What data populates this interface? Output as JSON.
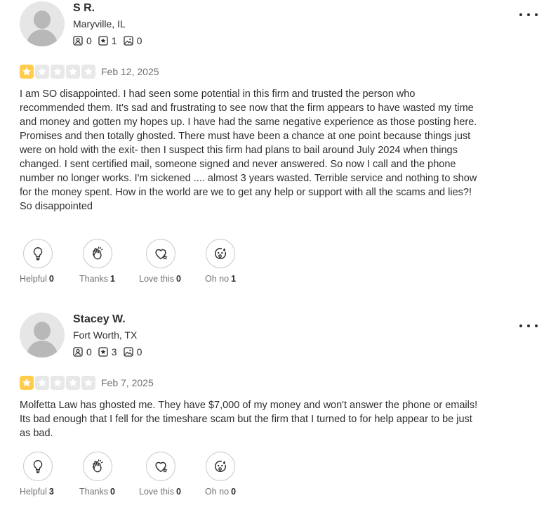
{
  "reviews": [
    {
      "user": {
        "name": "S R.",
        "location": "Maryville, IL",
        "friends": "0",
        "reviews": "1",
        "photos": "0"
      },
      "rating": 1,
      "date": "Feb 12, 2025",
      "text": [
        "I am SO disappointed. I had seen some potential in this firm and trusted the person who recommended them. It's sad and frustrating to see now that the firm appears to have wasted my time and money and gotten my hopes up. I have had the same negative experience as those posting here. Promises and then totally ghosted. There must have been a chance at one point because things just were on hold with the exit- then I suspect this firm had plans to bail around July 2024 when things changed. I sent certified mail, someone signed and never answered. So now I call and the phone number no longer works. I'm sickened .... almost 3 years wasted. Terrible service and nothing to show for the money spent. How in the world are we to get any help or support with all the scams and lies?!",
        "So disappointed"
      ],
      "reactions": {
        "helpful": {
          "label": "Helpful",
          "count": "0"
        },
        "thanks": {
          "label": "Thanks",
          "count": "1"
        },
        "love": {
          "label": "Love this",
          "count": "0"
        },
        "ohno": {
          "label": "Oh no",
          "count": "1"
        }
      }
    },
    {
      "user": {
        "name": "Stacey W.",
        "location": "Fort Worth, TX",
        "friends": "0",
        "reviews": "3",
        "photos": "0"
      },
      "rating": 1,
      "date": "Feb 7, 2025",
      "text": [
        "Molfetta Law has ghosted me. They have $7,000 of my money and won't answer the phone or emails! Its bad enough that I fell for the timeshare scam but the firm that I turned to for help appear to be just as bad."
      ],
      "reactions": {
        "helpful": {
          "label": "Helpful",
          "count": "3"
        },
        "thanks": {
          "label": "Thanks",
          "count": "0"
        },
        "love": {
          "label": "Love this",
          "count": "0"
        },
        "ohno": {
          "label": "Oh no",
          "count": "0"
        }
      }
    }
  ],
  "icons": {
    "friends": "friends-icon",
    "reviews": "review-star-icon",
    "photos": "photo-icon",
    "more": "more-options-icon",
    "helpful": "lightbulb-icon",
    "thanks": "clapping-hands-icon",
    "love": "heart-icon",
    "ohno": "oh-no-face-icon"
  },
  "colors": {
    "star_on": "#ffcc4b",
    "star_off": "#e8e8e8",
    "text": "#2d2e2f",
    "muted": "#6e7072"
  }
}
